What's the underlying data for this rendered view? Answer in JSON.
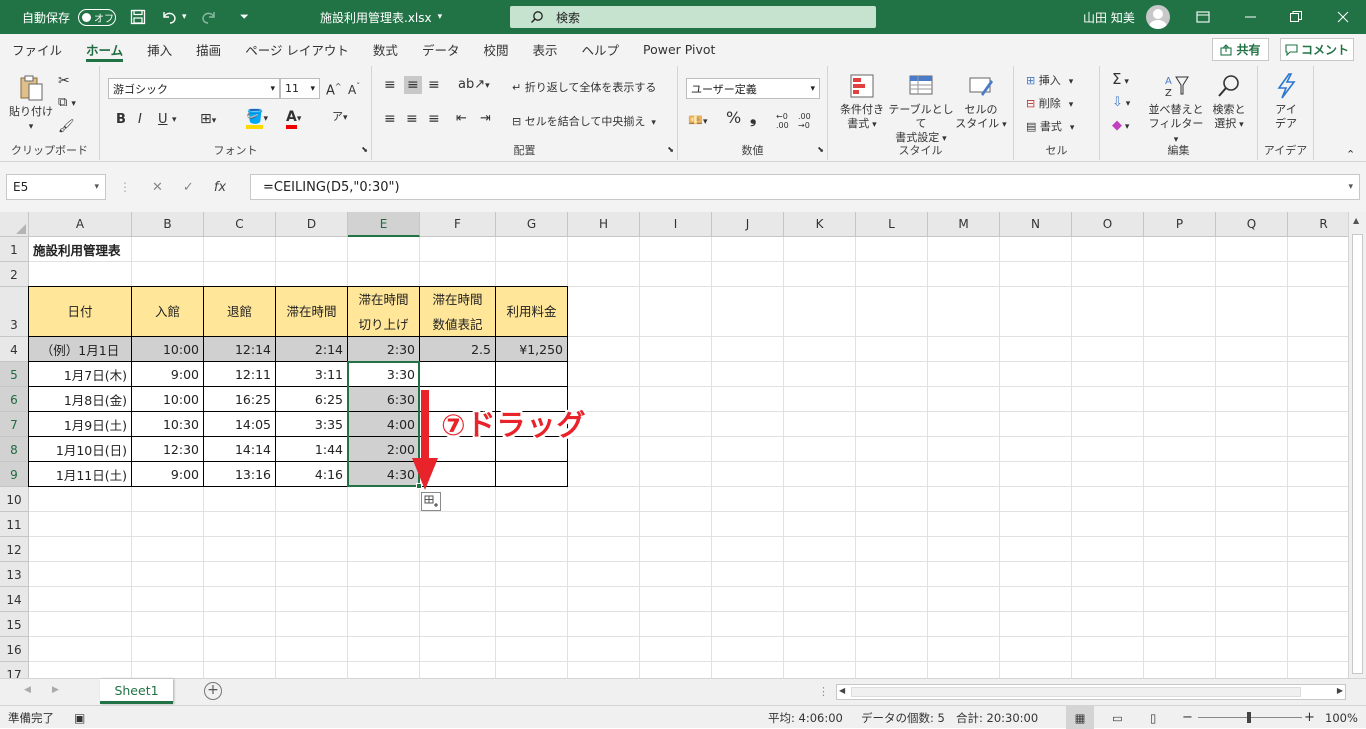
{
  "titlebar": {
    "autosave_label": "自動保存",
    "autosave_state": "オフ",
    "filename": "施設利用管理表.xlsx",
    "search_placeholder": "検索",
    "user_name": "山田 知美"
  },
  "tabs": [
    "ファイル",
    "ホーム",
    "挿入",
    "描画",
    "ページ レイアウト",
    "数式",
    "データ",
    "校閲",
    "表示",
    "ヘルプ",
    "Power Pivot"
  ],
  "active_tab": "ホーム",
  "share_label": "共有",
  "comment_label": "コメント",
  "ribbon": {
    "clipboard": {
      "paste": "貼り付け",
      "label": "クリップボード"
    },
    "font": {
      "name": "游ゴシック",
      "size": "11",
      "bold": "B",
      "italic": "I",
      "underline": "U",
      "label": "フォント"
    },
    "alignment": {
      "wrap": "折り返して全体を表示する",
      "merge": "セルを結合して中央揃え",
      "label": "配置"
    },
    "number": {
      "format": "ユーザー定義",
      "label": "数値"
    },
    "styles": {
      "conditional_1": "条件付き",
      "conditional_2": "書式",
      "table_1": "テーブルとして",
      "table_2": "書式設定",
      "cell_1": "セルの",
      "cell_2": "スタイル",
      "label": "スタイル"
    },
    "cells": {
      "insert": "挿入",
      "delete": "削除",
      "format": "書式",
      "label": "セル"
    },
    "editing": {
      "sort_1": "並べ替えと",
      "sort_2": "フィルター",
      "find_1": "検索と",
      "find_2": "選択",
      "label": "編集"
    },
    "ideas": {
      "ideas_1": "アイ",
      "ideas_2": "デア",
      "label": "アイデア"
    }
  },
  "formula_bar": {
    "name_box": "E5",
    "formula": "=CEILING(D5,\"0:30\")"
  },
  "columns": [
    "A",
    "B",
    "C",
    "D",
    "E",
    "F",
    "G",
    "H",
    "I",
    "J",
    "K",
    "L",
    "M",
    "N",
    "O",
    "P",
    "Q",
    "R"
  ],
  "rows": [
    "1",
    "2",
    "3",
    "4",
    "5",
    "6",
    "7",
    "8",
    "9",
    "10",
    "11",
    "12",
    "13",
    "14",
    "15",
    "16",
    "17"
  ],
  "sheet": {
    "title": "施設利用管理表",
    "headers": [
      "日付",
      "入館",
      "退館",
      "滞在時間",
      "滞在時間\n切り上げ",
      "滞在時間\n数値表記",
      "利用料金"
    ],
    "header_E_1": "滞在時間",
    "header_E_2": "切り上げ",
    "header_F_1": "滞在時間",
    "header_F_2": "数値表記",
    "data": [
      [
        "（例）1月1日",
        "10:00",
        "12:14",
        "2:14",
        "2:30",
        "2.5",
        "¥1,250"
      ],
      [
        "1月7日(木)",
        "9:00",
        "12:11",
        "3:11",
        "3:30",
        "",
        ""
      ],
      [
        "1月8日(金)",
        "10:00",
        "16:25",
        "6:25",
        "6:30",
        "",
        ""
      ],
      [
        "1月9日(土)",
        "10:30",
        "14:05",
        "3:35",
        "4:00",
        "",
        ""
      ],
      [
        "1月10日(日)",
        "12:30",
        "14:14",
        "1:44",
        "2:00",
        "",
        ""
      ],
      [
        "1月11日(土)",
        "9:00",
        "13:16",
        "4:16",
        "4:30",
        "",
        ""
      ]
    ]
  },
  "annotation": "⑦ドラッグ",
  "sheet_tab": "Sheet1",
  "status": {
    "ready": "準備完了",
    "average": "平均: 4:06:00",
    "count": "データの個数: 5",
    "sum": "合計: 20:30:00",
    "zoom": "100%"
  },
  "colors": {
    "accent": "#217346",
    "header_fill": "#ffe699",
    "example_fill": "#d0d0d0",
    "annotation": "#e8232a"
  }
}
